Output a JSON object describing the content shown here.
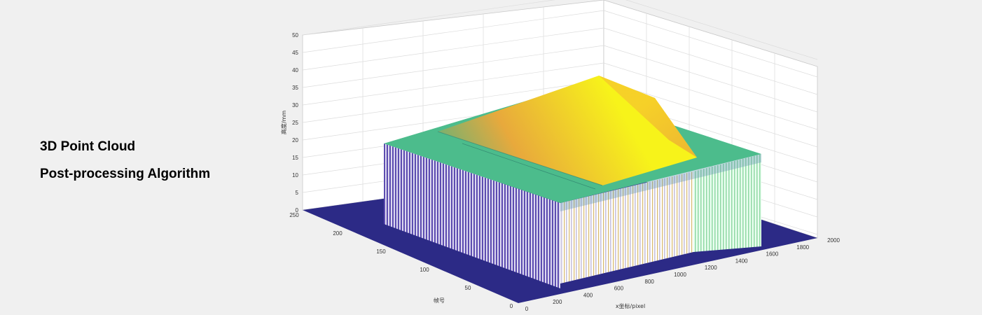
{
  "caption": {
    "line1": "3D Point Cloud",
    "line2": "Post-processing Algorithm"
  },
  "colors": {
    "background": "#f0f0f0",
    "floor": "#2c2a86",
    "top_low": "#44b487",
    "top_mid": "#f0a838",
    "top_high": "#f7f31a",
    "side_front": "#5c4cb0",
    "side_right_a": "#d7a63a",
    "side_right_b": "#8fd7a3"
  },
  "chart_data": {
    "type": "surface",
    "title": "",
    "xlabel": "x坐标/pixel",
    "ylabel": "帧号",
    "zlabel": "高度/mm",
    "xlim": [
      0,
      2000
    ],
    "ylim": [
      0,
      250
    ],
    "zlim": [
      0,
      50
    ],
    "x_ticks": [
      "0",
      "200",
      "400",
      "600",
      "800",
      "1000",
      "1200",
      "1400",
      "1600",
      "1800",
      "2000"
    ],
    "y_ticks": [
      "0",
      "50",
      "100",
      "150",
      "200",
      "250"
    ],
    "z_ticks": [
      "0",
      "5",
      "10",
      "15",
      "20",
      "25",
      "30",
      "35",
      "40",
      "45",
      "50"
    ],
    "grid": true,
    "surface": {
      "x_range": [
        220,
        1760
      ],
      "y_range": [
        0,
        210
      ],
      "base_height": 20,
      "ridge_x": [
        480,
        1350
      ],
      "ridge_peak_height": 38
    }
  }
}
